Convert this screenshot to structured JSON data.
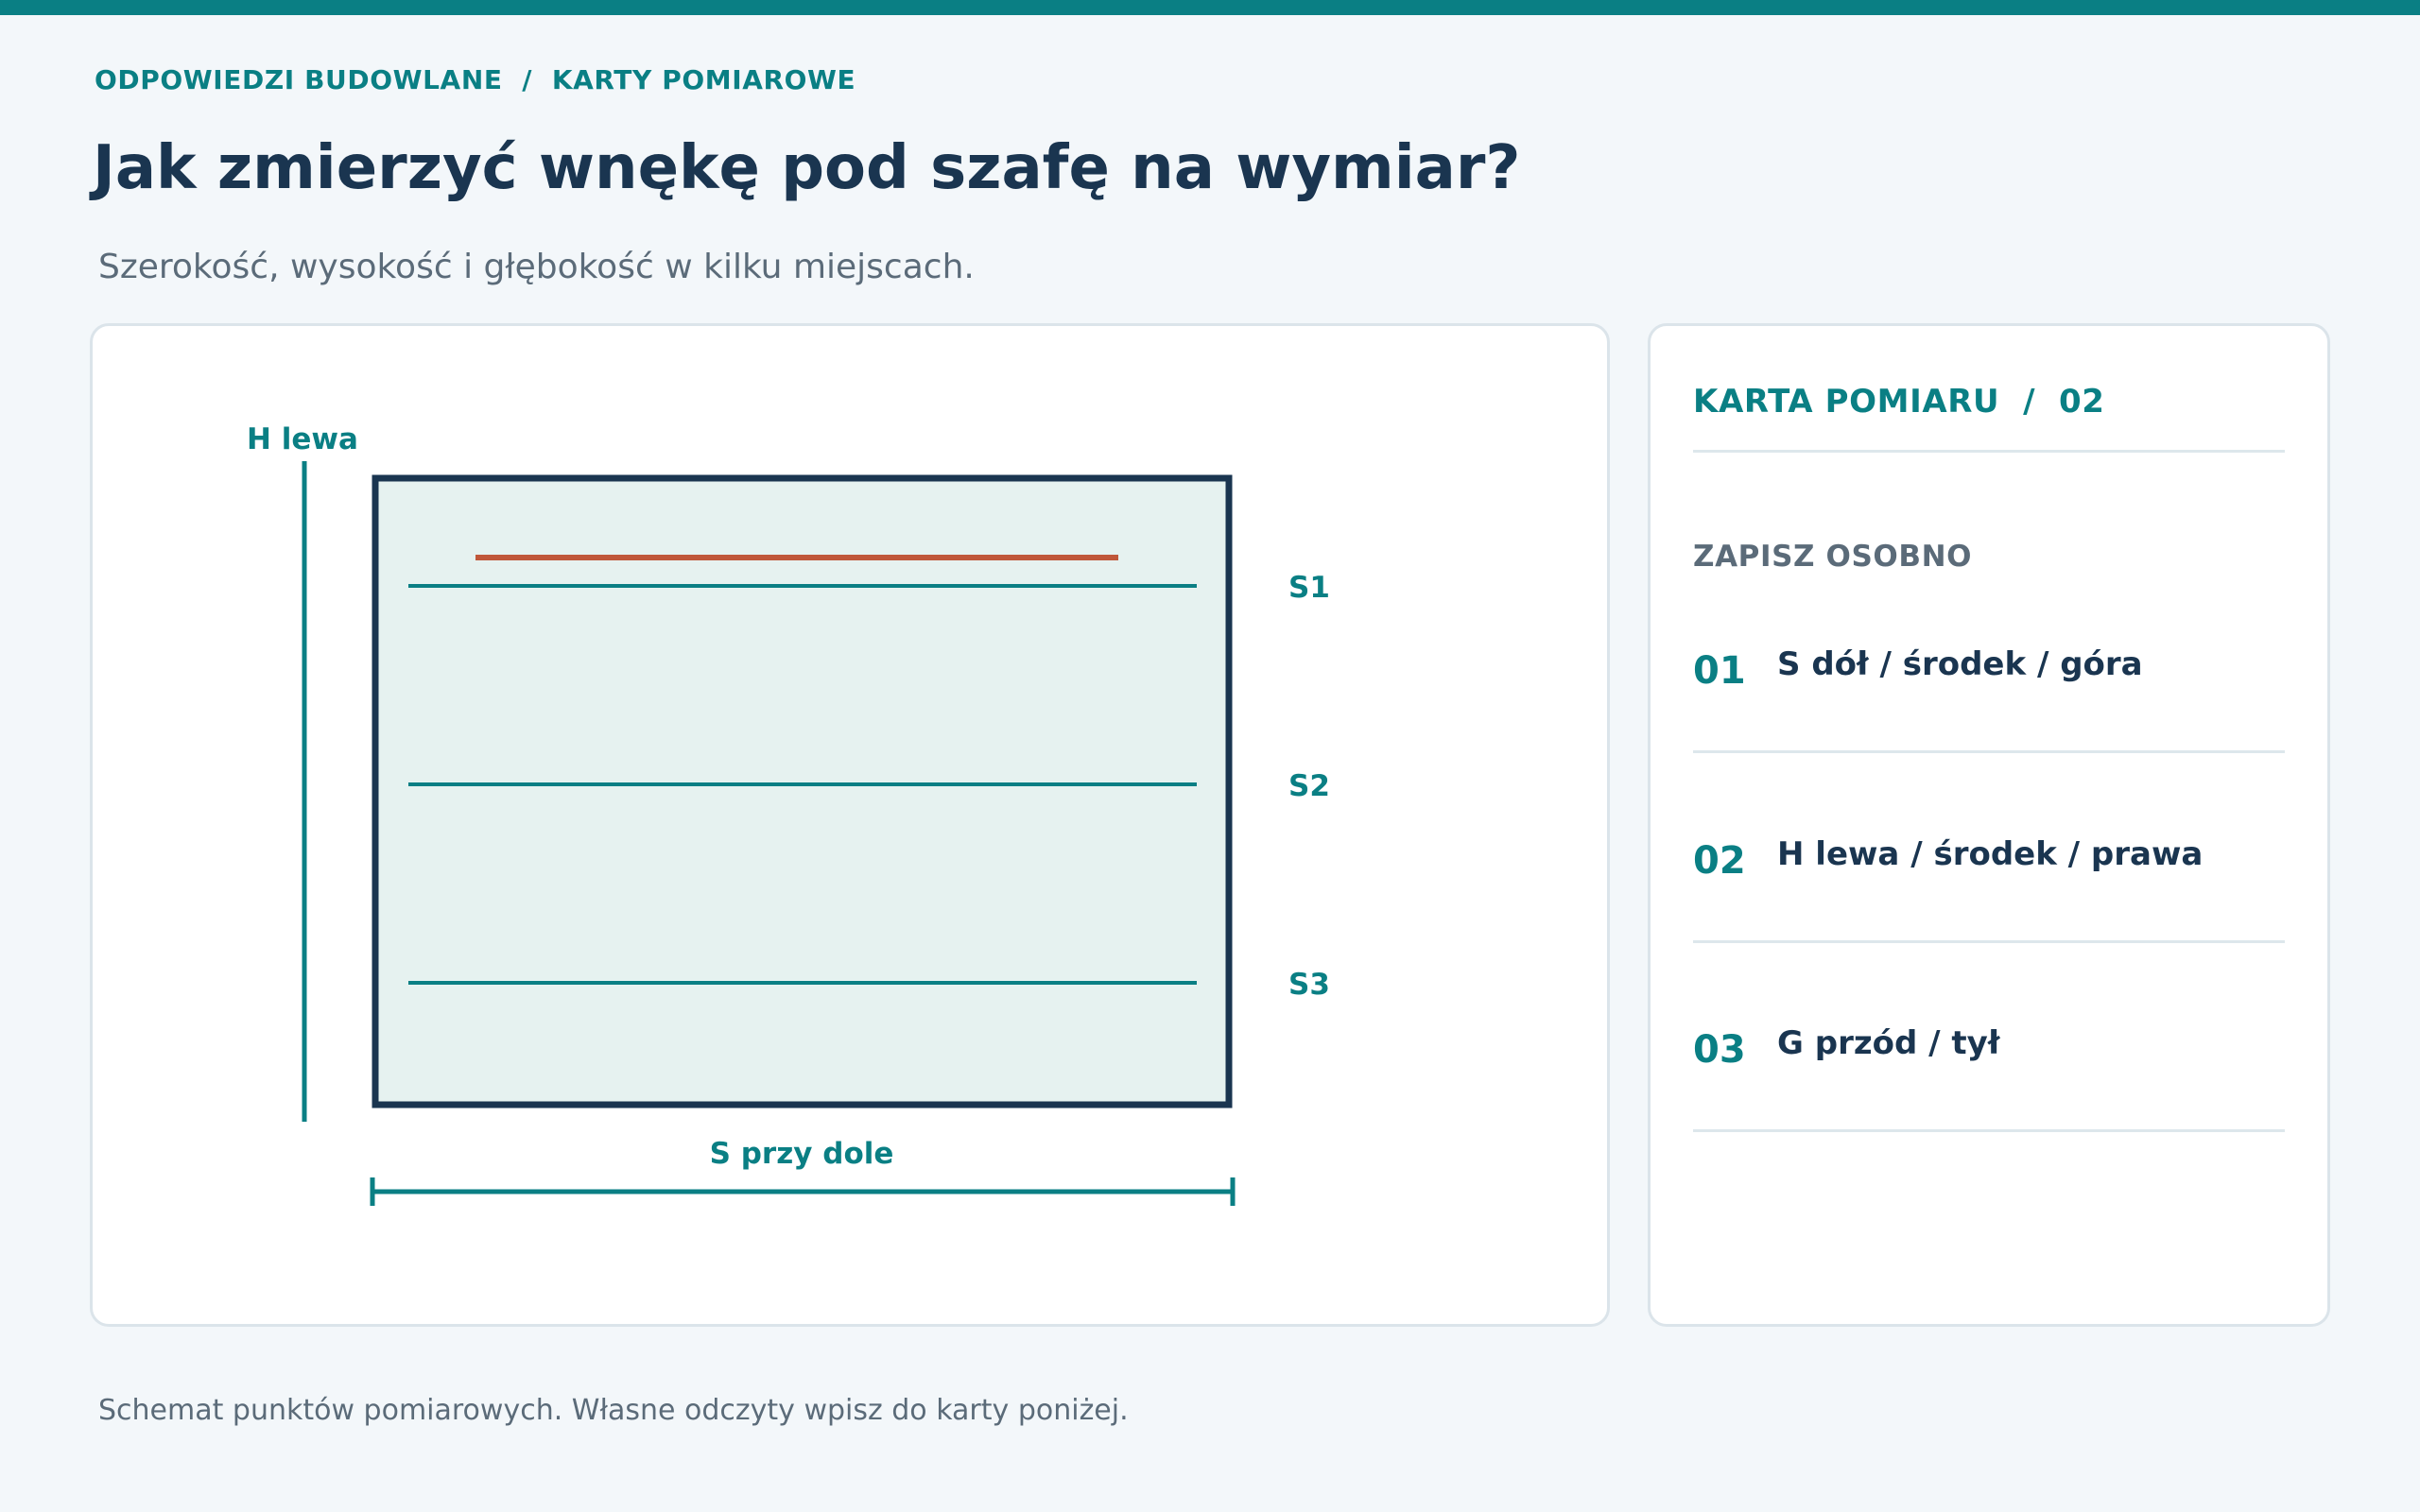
{
  "breadcrumb": {
    "section": "ODPOWIEDZI BUDOWLANE",
    "separator": "/",
    "page": "KARTY POMIAROWE"
  },
  "title": "Jak zmierzyć wnękę pod szafę na wymiar?",
  "subtitle": "Szerokość, wysokość i głębokość w kilku miejscach.",
  "diagram": {
    "height_label": "H lewa",
    "width_label": "S przy dole",
    "width_lines": [
      "S1",
      "S2",
      "S3"
    ]
  },
  "card": {
    "title": "KARTA POMIARU",
    "separator": "/",
    "number": "02",
    "section": "ZAPISZ OSOBNO",
    "items": [
      {
        "num": "01",
        "text": "S dół / środek / góra"
      },
      {
        "num": "02",
        "text": "H lewa / środek / prawa"
      },
      {
        "num": "03",
        "text": "G przód / tył"
      }
    ]
  },
  "caption": "Schemat punktów pomiarowych. Własne odczyty wpisz do karty poniżej.",
  "colors": {
    "accent": "#0a7f84",
    "frame": "#1a3550",
    "marker": "#c0573a",
    "niche_fill": "#e6f2f0",
    "background": "#f3f7fa"
  }
}
